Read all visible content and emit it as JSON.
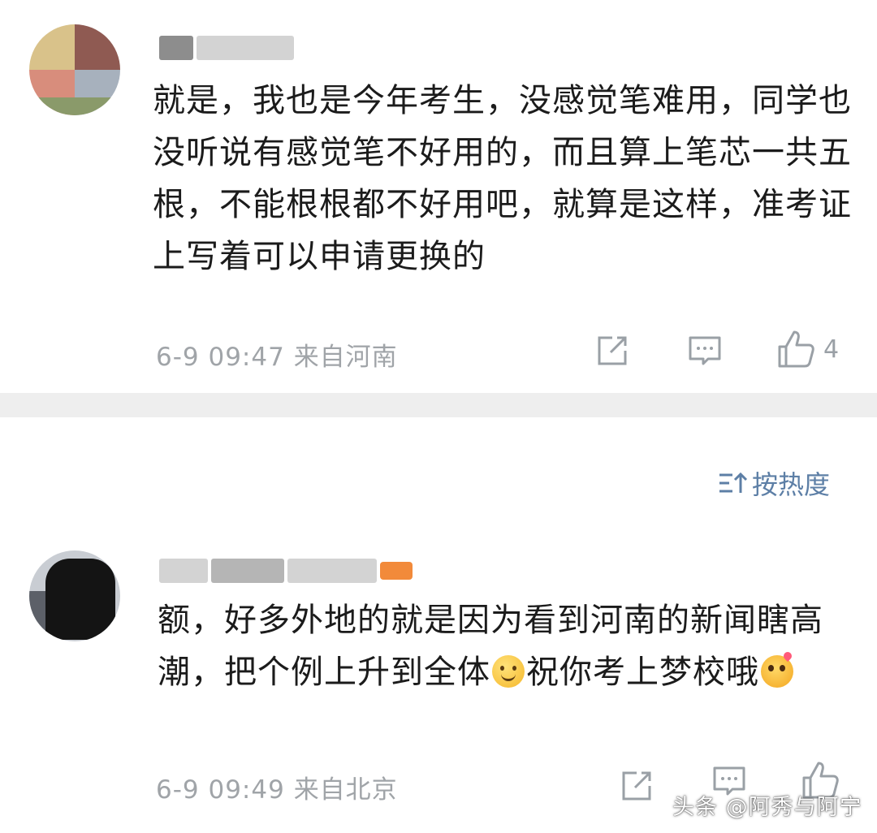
{
  "comments": [
    {
      "text": "就是，我也是今年考生，没感觉笔难用，同学也没听说有感觉笔不好用的，而且算上笔芯一共五根，不能根根都不好用吧，就算是这样，准考证上写着可以申请更换的",
      "time": "6-9 09:47",
      "location": "来自河南",
      "like_count": "4"
    },
    {
      "text_part1": "额，好多外地的就是因为看到河南的新闻瞎高潮，把个例上升到全体",
      "text_part2": "祝你考上梦校哦",
      "emoji1": "smile-emoji",
      "emoji2": "love-emoji",
      "time": "6-9 09:49",
      "location": "来自北京"
    }
  ],
  "sort": {
    "label": "按热度",
    "icon": "sort-icon"
  },
  "watermark": "头条 @阿秀与阿宁",
  "icons": {
    "share": "share-icon",
    "reply": "comment-icon",
    "like": "thumbs-up-icon"
  },
  "colors": {
    "meta_text": "#a0a4a8",
    "link_blue": "#5d7fa6",
    "divider": "#eeeeee"
  }
}
